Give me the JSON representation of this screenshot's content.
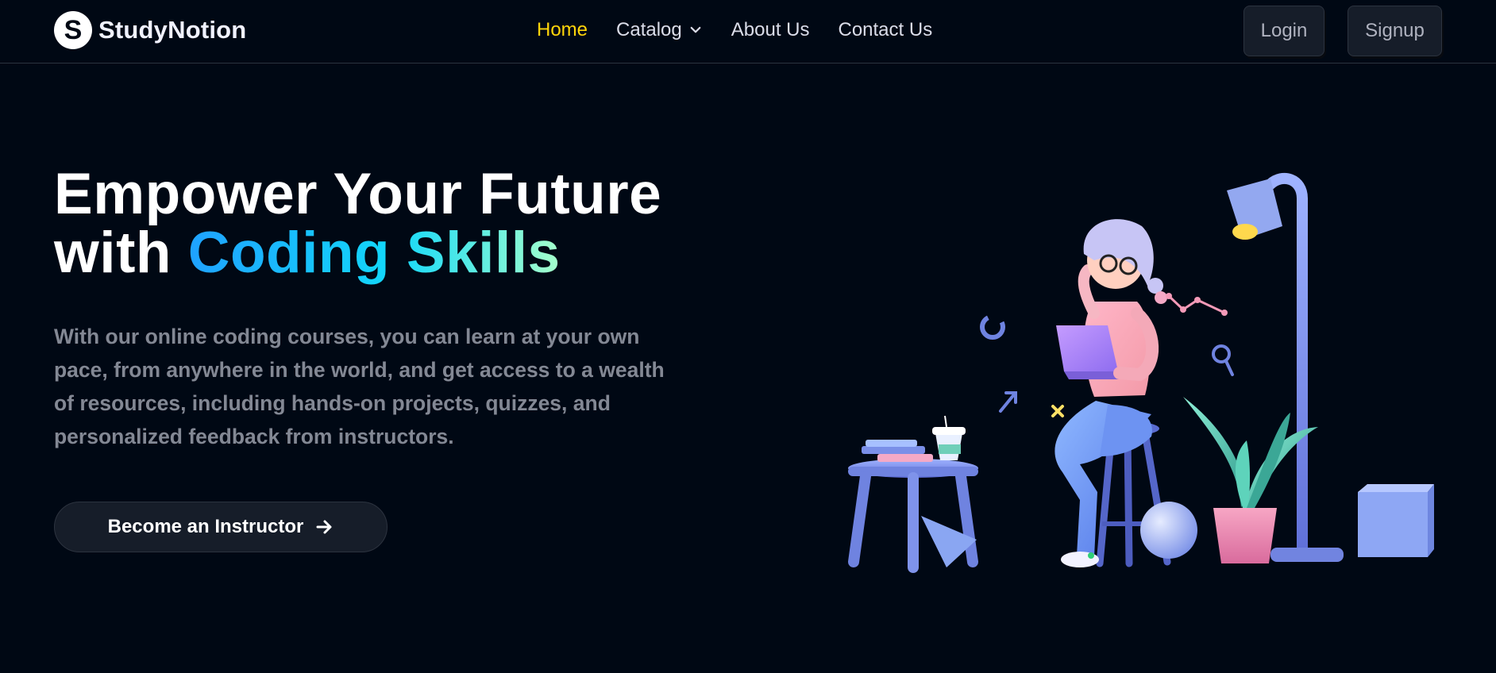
{
  "brand": {
    "name": "StudyNotion",
    "logo_letter": "S"
  },
  "nav": {
    "items": [
      {
        "label": "Home",
        "active": true
      },
      {
        "label": "Catalog",
        "active": false,
        "has_dropdown": true
      },
      {
        "label": "About Us",
        "active": false
      },
      {
        "label": "Contact Us",
        "active": false
      }
    ],
    "login_label": "Login",
    "signup_label": "Signup"
  },
  "hero": {
    "headline_prefix_line1": "Empower Your Future",
    "headline_prefix_line2": "with ",
    "headline_highlight": "Coding Skills",
    "description": "With our online coding courses, you can learn at your own pace, from anywhere in the world, and get access to a wealth of resources, including hands-on projects, quizzes, and personalized feedback from instructors.",
    "cta_label": "Become an Instructor"
  },
  "colors": {
    "background": "#000814",
    "active_nav": "#ffd60a",
    "gradient": [
      "#1fa2ff",
      "#12d8fa",
      "#a6ffcb"
    ]
  },
  "icons": [
    "chevron-down-icon",
    "arrow-right-icon"
  ]
}
